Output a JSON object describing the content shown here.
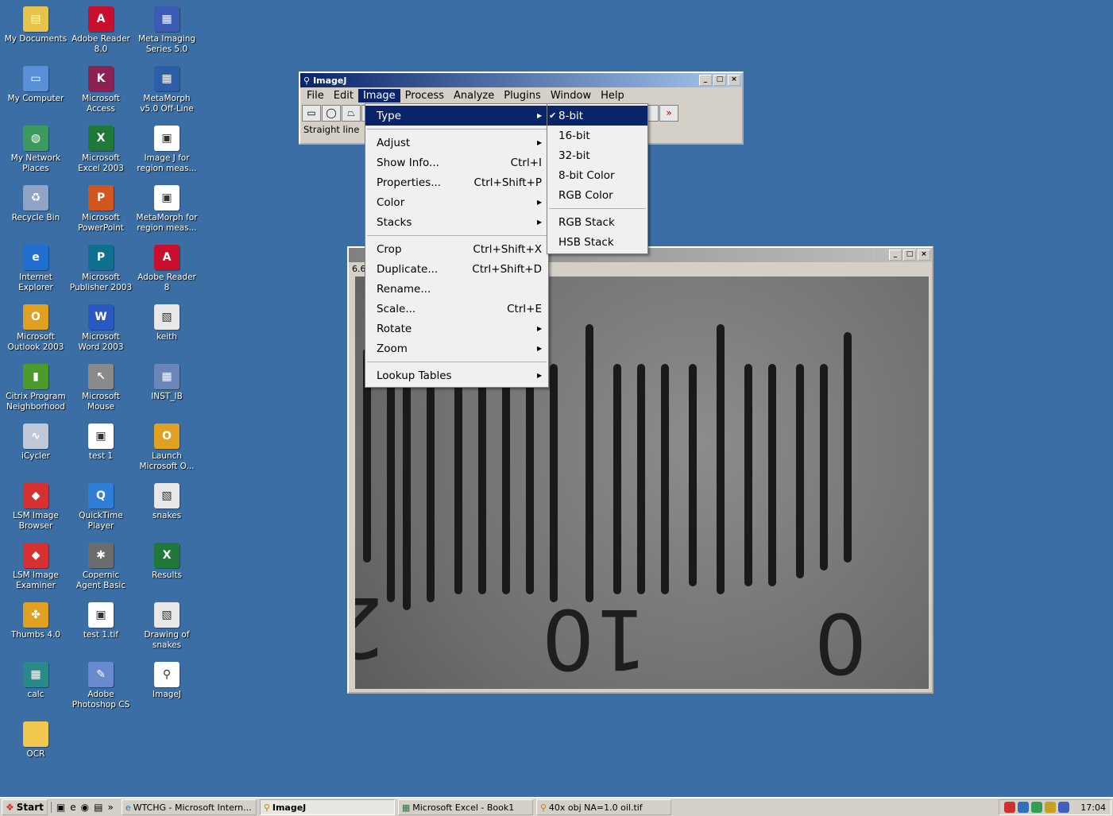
{
  "desktop_icons": [
    {
      "label": "My Documents",
      "icon": "folder-documents-icon",
      "color": "#e8c34a",
      "glyph": "▤"
    },
    {
      "label": "Adobe Reader\n8.0",
      "icon": "adobe-reader-icon",
      "color": "#c8102e",
      "glyph": "A"
    },
    {
      "label": "Meta Imaging\nSeries 5.0",
      "icon": "meta-imaging-icon",
      "color": "#3b5bb5",
      "glyph": "▦"
    },
    {
      "label": "My Computer",
      "icon": "computer-icon",
      "color": "#5b8fd6",
      "glyph": "▭"
    },
    {
      "label": "Microsoft\nAccess",
      "icon": "access-icon",
      "color": "#8b2252",
      "glyph": "K"
    },
    {
      "label": "MetaMorph\nv5.0 Off-Line",
      "icon": "metamorph-icon",
      "color": "#2d5fa8",
      "glyph": "▦"
    },
    {
      "label": "My Network\nPlaces",
      "icon": "network-icon",
      "color": "#3c9a5f",
      "glyph": "◍"
    },
    {
      "label": "Microsoft\nExcel 2003",
      "icon": "excel-icon",
      "color": "#1f7a3a",
      "glyph": "X"
    },
    {
      "label": "Image J for\nregion meas...",
      "icon": "shortcut-file-icon",
      "color": "#ffffff",
      "glyph": "▣"
    },
    {
      "label": "Recycle Bin",
      "icon": "recycle-bin-icon",
      "color": "#8fa4c4",
      "glyph": "♻"
    },
    {
      "label": "Microsoft\nPowerPoint",
      "icon": "powerpoint-icon",
      "color": "#d2571e",
      "glyph": "P"
    },
    {
      "label": "MetaMorph for\nregion meas...",
      "icon": "shortcut-file-icon",
      "color": "#ffffff",
      "glyph": "▣"
    },
    {
      "label": "Internet\nExplorer",
      "icon": "internet-explorer-icon",
      "color": "#1e6fd0",
      "glyph": "e"
    },
    {
      "label": "Microsoft\nPublisher 2003",
      "icon": "publisher-icon",
      "color": "#0f6f8f",
      "glyph": "P"
    },
    {
      "label": "Adobe Reader\n8",
      "icon": "adobe-reader-icon",
      "color": "#c8102e",
      "glyph": "A"
    },
    {
      "label": "Microsoft\nOutlook 2003",
      "icon": "outlook-icon",
      "color": "#e0a020",
      "glyph": "O"
    },
    {
      "label": "Microsoft\nWord 2003",
      "icon": "word-icon",
      "color": "#2a57c0",
      "glyph": "W"
    },
    {
      "label": "keith",
      "icon": "jpeg-file-icon",
      "color": "#e8e8e8",
      "glyph": "▧"
    },
    {
      "label": "Citrix Program\nNeighborhood",
      "icon": "citrix-icon",
      "color": "#4c9a2a",
      "glyph": "▮"
    },
    {
      "label": "Microsoft\nMouse",
      "icon": "mouse-icon",
      "color": "#8a8a8a",
      "glyph": "↖"
    },
    {
      "label": "INST_IB",
      "icon": "inst-ib-icon",
      "color": "#6a86b8",
      "glyph": "▦"
    },
    {
      "label": "iCycler",
      "icon": "icycler-icon",
      "color": "#c0c8d8",
      "glyph": "∿"
    },
    {
      "label": "test 1",
      "icon": "shortcut-file-icon",
      "color": "#ffffff",
      "glyph": "▣"
    },
    {
      "label": "Launch\nMicrosoft O...",
      "icon": "outlook-icon",
      "color": "#e0a020",
      "glyph": "O"
    },
    {
      "label": "LSM Image\nBrowser",
      "icon": "lsm-browser-icon",
      "color": "#d63030",
      "glyph": "◆"
    },
    {
      "label": "QuickTime\nPlayer",
      "icon": "quicktime-icon",
      "color": "#2f7fd8",
      "glyph": "Q"
    },
    {
      "label": "snakes",
      "icon": "jpeg-file-icon",
      "color": "#e8e8e8",
      "glyph": "▧"
    },
    {
      "label": "LSM Image\nExaminer",
      "icon": "lsm-examiner-icon",
      "color": "#d63030",
      "glyph": "◆"
    },
    {
      "label": "Copernic\nAgent Basic",
      "icon": "copernic-icon",
      "color": "#6c6c6c",
      "glyph": "✱"
    },
    {
      "label": "Results",
      "icon": "excel-file-icon",
      "color": "#1f7a3a",
      "glyph": "X"
    },
    {
      "label": "Thumbs 4.0",
      "icon": "thumbs-icon",
      "color": "#e0a020",
      "glyph": "✤"
    },
    {
      "label": "test 1.tif",
      "icon": "shortcut-file-icon",
      "color": "#ffffff",
      "glyph": "▣"
    },
    {
      "label": "Drawing of\nsnakes",
      "icon": "jpeg-file-icon",
      "color": "#e8e8e8",
      "glyph": "▧"
    },
    {
      "label": "calc",
      "icon": "calculator-icon",
      "color": "#2a8a8a",
      "glyph": "▦"
    },
    {
      "label": "Adobe\nPhotoshop CS",
      "icon": "photoshop-icon",
      "color": "#6a8ad0",
      "glyph": "✎"
    },
    {
      "label": "ImageJ",
      "icon": "microscope-icon",
      "color": "#ffffff",
      "glyph": "⚲"
    },
    {
      "label": "OCR",
      "icon": "folder-icon",
      "color": "#f0c850",
      "glyph": ""
    }
  ],
  "imagej": {
    "title": "ImageJ",
    "menus": [
      "File",
      "Edit",
      "Image",
      "Process",
      "Analyze",
      "Plugins",
      "Window",
      "Help"
    ],
    "active_menu": "Image",
    "status": "Straight line",
    "tools": [
      "▭",
      "◯",
      "⏢",
      "",
      "",
      "",
      "",
      "",
      "",
      "",
      "",
      "",
      "",
      "",
      "/",
      "⌖",
      "",
      "",
      "»"
    ]
  },
  "image_menu": [
    {
      "label": "Type",
      "shortcut": "",
      "submenu": true,
      "selected": true
    },
    {
      "sep": true
    },
    {
      "label": "Adjust",
      "shortcut": "",
      "submenu": true
    },
    {
      "label": "Show Info...",
      "shortcut": "Ctrl+I"
    },
    {
      "label": "Properties...",
      "shortcut": "Ctrl+Shift+P"
    },
    {
      "label": "Color",
      "shortcut": "",
      "submenu": true
    },
    {
      "label": "Stacks",
      "shortcut": "",
      "submenu": true
    },
    {
      "sep": true
    },
    {
      "label": "Crop",
      "shortcut": "Ctrl+Shift+X"
    },
    {
      "label": "Duplicate...",
      "shortcut": "Ctrl+Shift+D"
    },
    {
      "label": "Rename..."
    },
    {
      "label": "Scale...",
      "shortcut": "Ctrl+E"
    },
    {
      "label": "Rotate",
      "submenu": true
    },
    {
      "label": "Zoom",
      "submenu": true
    },
    {
      "sep": true
    },
    {
      "label": "Lookup Tables",
      "submenu": true
    }
  ],
  "type_submenu": [
    {
      "label": "8-bit",
      "checked": true,
      "selected": true
    },
    {
      "label": "16-bit"
    },
    {
      "label": "32-bit"
    },
    {
      "label": "8-bit Color"
    },
    {
      "label": "RGB Color"
    },
    {
      "sep": true
    },
    {
      "label": "RGB Stack"
    },
    {
      "label": "HSB Stack"
    }
  ],
  "image_window": {
    "title": "",
    "info": "6.6",
    "scale_labels": [
      "10",
      "0",
      "2"
    ]
  },
  "taskbar": {
    "start_label": "Start",
    "quick_launch": [
      "▣",
      "e",
      "◉",
      "▤",
      "»"
    ],
    "tasks": [
      {
        "label": "WTCHG - Microsoft Intern...",
        "icon": "internet-explorer-icon",
        "active": false
      },
      {
        "label": "ImageJ",
        "icon": "microscope-icon",
        "active": true
      },
      {
        "label": "Microsoft Excel - Book1",
        "icon": "excel-icon",
        "active": false
      },
      {
        "label": "40x obj NA=1.0 oil.tif",
        "icon": "microscope-icon",
        "active": false
      }
    ],
    "clock": "17:04",
    "tray_colors": [
      "#d03030",
      "#3070c0",
      "#30a050",
      "#c8a020",
      "#4060c0"
    ]
  }
}
